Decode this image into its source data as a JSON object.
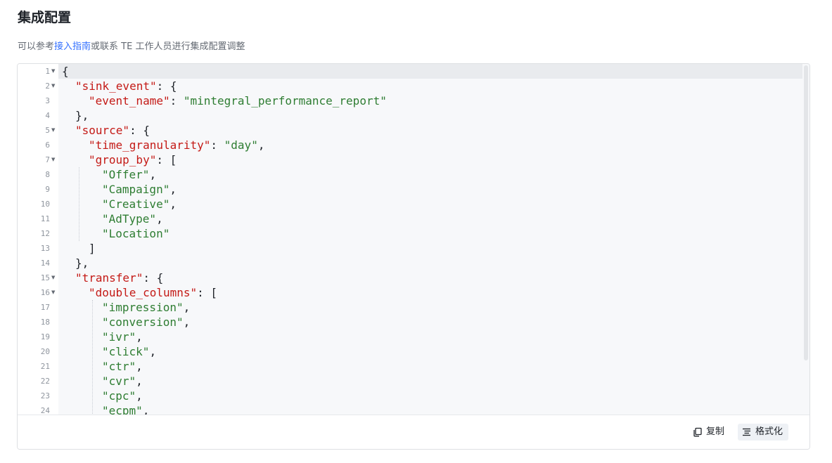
{
  "header": {
    "title": "集成配置",
    "hint_prefix": "可以参考",
    "hint_link": "接入指南",
    "hint_suffix": "或联系 TE 工作人员进行集成配置调整"
  },
  "editor": {
    "lines": [
      {
        "n": "1",
        "fold": true,
        "indent": 0,
        "parts": [
          [
            "p",
            "{"
          ]
        ]
      },
      {
        "n": "2",
        "fold": true,
        "indent": 1,
        "parts": [
          [
            "k",
            "\"sink_event\""
          ],
          [
            "p",
            ": {"
          ]
        ]
      },
      {
        "n": "3",
        "fold": false,
        "indent": 2,
        "parts": [
          [
            "k",
            "\"event_name\""
          ],
          [
            "p",
            ": "
          ],
          [
            "s",
            "\"mintegral_performance_report\""
          ]
        ]
      },
      {
        "n": "4",
        "fold": false,
        "indent": 1,
        "parts": [
          [
            "p",
            "},"
          ]
        ]
      },
      {
        "n": "5",
        "fold": true,
        "indent": 1,
        "parts": [
          [
            "k",
            "\"source\""
          ],
          [
            "p",
            ": {"
          ]
        ]
      },
      {
        "n": "6",
        "fold": false,
        "indent": 2,
        "parts": [
          [
            "k",
            "\"time_granularity\""
          ],
          [
            "p",
            ": "
          ],
          [
            "s",
            "\"day\""
          ],
          [
            "p",
            ","
          ]
        ]
      },
      {
        "n": "7",
        "fold": true,
        "indent": 2,
        "parts": [
          [
            "k",
            "\"group_by\""
          ],
          [
            "p",
            ": ["
          ]
        ]
      },
      {
        "n": "8",
        "fold": false,
        "indent": 3,
        "parts": [
          [
            "s",
            "\"Offer\""
          ],
          [
            "p",
            ","
          ]
        ]
      },
      {
        "n": "9",
        "fold": false,
        "indent": 3,
        "parts": [
          [
            "s",
            "\"Campaign\""
          ],
          [
            "p",
            ","
          ]
        ]
      },
      {
        "n": "10",
        "fold": false,
        "indent": 3,
        "parts": [
          [
            "s",
            "\"Creative\""
          ],
          [
            "p",
            ","
          ]
        ]
      },
      {
        "n": "11",
        "fold": false,
        "indent": 3,
        "parts": [
          [
            "s",
            "\"AdType\""
          ],
          [
            "p",
            ","
          ]
        ]
      },
      {
        "n": "12",
        "fold": false,
        "indent": 3,
        "parts": [
          [
            "s",
            "\"Location\""
          ]
        ]
      },
      {
        "n": "13",
        "fold": false,
        "indent": 2,
        "parts": [
          [
            "p",
            "]"
          ]
        ]
      },
      {
        "n": "14",
        "fold": false,
        "indent": 1,
        "parts": [
          [
            "p",
            "},"
          ]
        ]
      },
      {
        "n": "15",
        "fold": true,
        "indent": 1,
        "parts": [
          [
            "k",
            "\"transfer\""
          ],
          [
            "p",
            ": {"
          ]
        ]
      },
      {
        "n": "16",
        "fold": true,
        "indent": 2,
        "parts": [
          [
            "k",
            "\"double_columns\""
          ],
          [
            "p",
            ": ["
          ]
        ]
      },
      {
        "n": "17",
        "fold": false,
        "indent": 3,
        "parts": [
          [
            "s",
            "\"impression\""
          ],
          [
            "p",
            ","
          ]
        ]
      },
      {
        "n": "18",
        "fold": false,
        "indent": 3,
        "parts": [
          [
            "s",
            "\"conversion\""
          ],
          [
            "p",
            ","
          ]
        ]
      },
      {
        "n": "19",
        "fold": false,
        "indent": 3,
        "parts": [
          [
            "s",
            "\"ivr\""
          ],
          [
            "p",
            ","
          ]
        ]
      },
      {
        "n": "20",
        "fold": false,
        "indent": 3,
        "parts": [
          [
            "s",
            "\"click\""
          ],
          [
            "p",
            ","
          ]
        ]
      },
      {
        "n": "21",
        "fold": false,
        "indent": 3,
        "parts": [
          [
            "s",
            "\"ctr\""
          ],
          [
            "p",
            ","
          ]
        ]
      },
      {
        "n": "22",
        "fold": false,
        "indent": 3,
        "parts": [
          [
            "s",
            "\"cvr\""
          ],
          [
            "p",
            ","
          ]
        ]
      },
      {
        "n": "23",
        "fold": false,
        "indent": 3,
        "parts": [
          [
            "s",
            "\"cpc\""
          ],
          [
            "p",
            ","
          ]
        ]
      },
      {
        "n": "24",
        "fold": false,
        "indent": 3,
        "parts": [
          [
            "s",
            "\"ecpm\""
          ],
          [
            "p",
            ","
          ]
        ]
      }
    ]
  },
  "toolbar": {
    "copy_label": "复制",
    "copy_icon": "copy-icon",
    "format_label": "格式化",
    "format_icon": "format-align-icon"
  },
  "colors": {
    "key": "#c41a16",
    "string": "#2e7d32",
    "link": "#3370ff"
  }
}
